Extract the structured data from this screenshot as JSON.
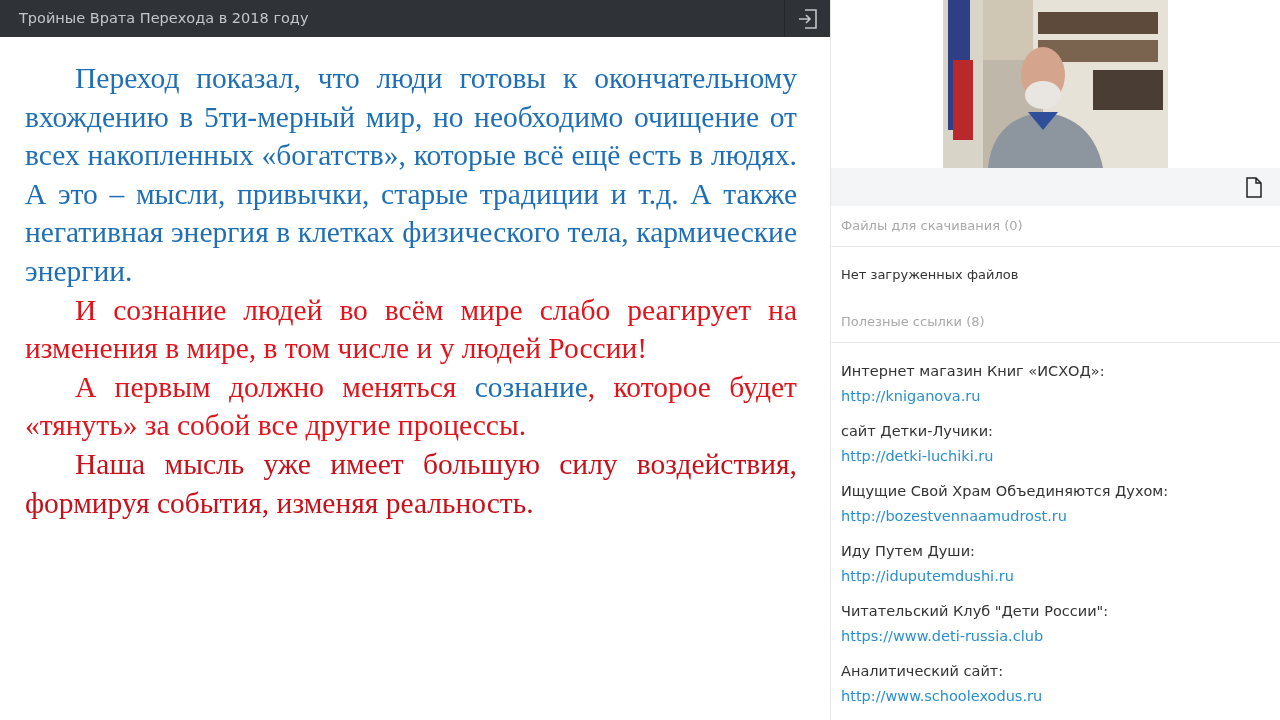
{
  "header": {
    "title": "Тройные Врата Перехода в 2018 году"
  },
  "slide": {
    "paragraphs": [
      {
        "segments": [
          {
            "text": "Переход показал, что люди готовы к окончательному вхождению в 5ти-мерный мир, но необходимо очищение от всех накопленных «богатств», которые всё ещё есть в людях. А это – мысли, привычки, старые традиции и т.д. А также негативная энергия в клетках физического тела, кармические энергии.",
            "color": "#1f6fb5"
          }
        ]
      },
      {
        "segments": [
          {
            "text": "И сознание людей во всём мире слабо реагирует на изменения в мире, в том числе и у людей России!",
            "color": "#e0141c"
          }
        ]
      },
      {
        "segments": [
          {
            "text": "А первым должно меняться ",
            "color": "#e0141c"
          },
          {
            "text": "сознание",
            "color": "#1f6fb5"
          },
          {
            "text": ", которое будет «тянуть» за собой все другие процессы.",
            "color": "#e0141c"
          }
        ]
      },
      {
        "segments": [
          {
            "text": "Наша мысль уже имеет большую силу воздействия, формируя события, изменяя реальность.",
            "color": "#c8101a"
          }
        ]
      }
    ]
  },
  "files": {
    "heading": "Файлы для скачивания (0)",
    "empty_text": "Нет загруженных файлов"
  },
  "links": {
    "heading": "Полезные ссылки (8)",
    "items": [
      {
        "label": "Интернет магазин Книг «ИСХОД»:",
        "url": "http://kniganova.ru"
      },
      {
        "label": "сайт Детки-Лучики:",
        "url": "http://detki-luchiki.ru"
      },
      {
        "label": "Ищущие Свой Храм Объединяются Духом:",
        "url": "http://bozestvennaamudrost.ru"
      },
      {
        "label": "Иду Путем Души:",
        "url": "http://iduputemdushi.ru"
      },
      {
        "label": "Читательский Клуб \"Дети России\":",
        "url": "https://www.deti-russia.club"
      },
      {
        "label": "Аналитический сайт:",
        "url": "http://www.schoolexodus.ru"
      }
    ]
  }
}
